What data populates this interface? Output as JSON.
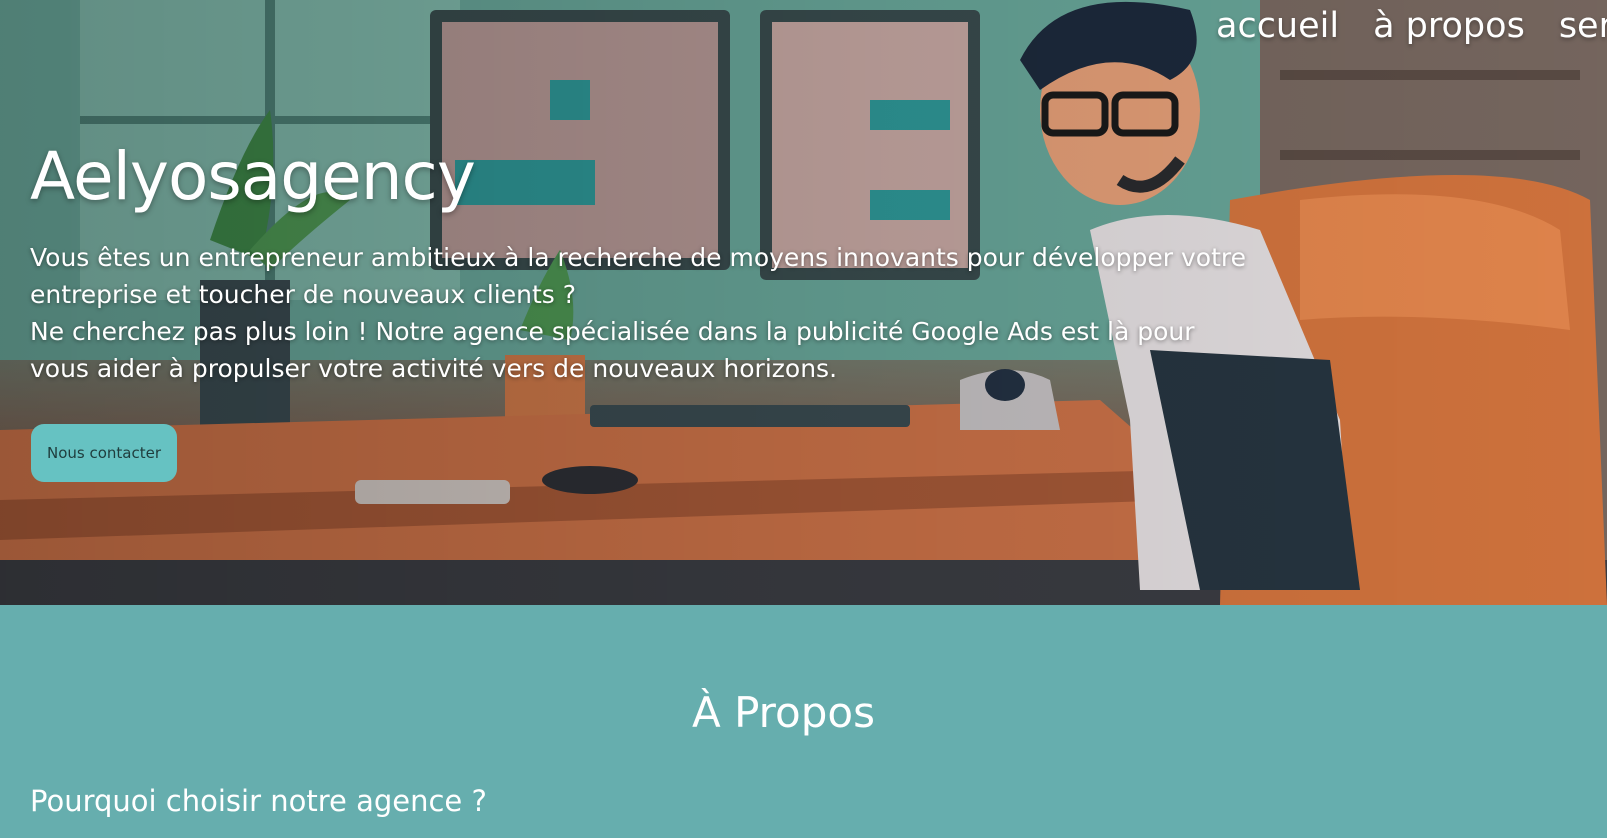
{
  "nav": {
    "items": [
      "accueil",
      "à propos",
      "ser"
    ]
  },
  "hero": {
    "title": "Aelyosagency",
    "paragraph_1": "Vous êtes un entrepreneur ambitieux à la recherche de moyens innovants pour développer votre entreprise et toucher de nouveaux clients ?",
    "paragraph_2": "Ne cherchez pas plus loin ! Notre agence spécialisée dans la publicité Google Ads est là pour vous aider à propulser votre activité vers de nouveaux horizons.",
    "cta_label": "Nous contacter",
    "illustration": "illustrated man with glasses at desk with computer monitors"
  },
  "about": {
    "title": "À Propos",
    "subtitle": "Pourquoi choisir notre agence ?"
  },
  "colors": {
    "section_bg": "#66aeae",
    "cta_bg": "#66c2c2",
    "text": "#ffffff"
  }
}
